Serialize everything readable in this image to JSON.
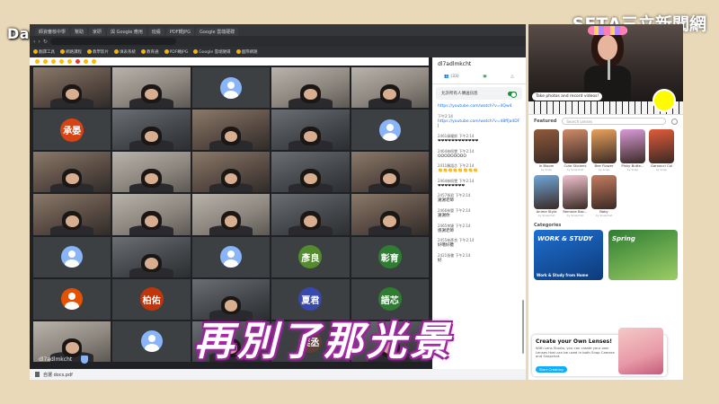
{
  "overlay": {
    "credit": "Day Liou 授權",
    "logo": "SETΛ三立新聞網"
  },
  "browser": {
    "tabs": [
      "師資審核中學",
      "幫助",
      "家研",
      "與 Google 應用",
      "班級",
      "PDF轉JPG",
      "Google 雲端硬碟"
    ],
    "bookmarks": [
      "翻譯工具",
      "網路課程",
      "教學影片",
      "填表系統",
      "教育通",
      "PDF轉JPG",
      "Google 雲端硬碟",
      "國際網路"
    ]
  },
  "meet": {
    "tiles": [
      {
        "kind": "cam",
        "tone": "warm"
      },
      {
        "kind": "cam",
        "tone": "light"
      },
      {
        "kind": "default"
      },
      {
        "kind": "cam",
        "tone": "light"
      },
      {
        "kind": "cam",
        "tone": "light"
      },
      {
        "kind": "initials",
        "label": "承晏",
        "color": "#d84315"
      },
      {
        "kind": "cam",
        "tone": "dark"
      },
      {
        "kind": "cam",
        "tone": "warm"
      },
      {
        "kind": "cam",
        "tone": "dark"
      },
      {
        "kind": "default"
      },
      {
        "kind": "cam",
        "tone": "warm"
      },
      {
        "kind": "cam",
        "tone": "light"
      },
      {
        "kind": "cam",
        "tone": "warm"
      },
      {
        "kind": "cam",
        "tone": "dark"
      },
      {
        "kind": "cam",
        "tone": "warm"
      },
      {
        "kind": "cam",
        "tone": "warm"
      },
      {
        "kind": "cam",
        "tone": "light"
      },
      {
        "kind": "cam",
        "tone": "light"
      },
      {
        "kind": "cam",
        "tone": "dark"
      },
      {
        "kind": "cam",
        "tone": "warm"
      },
      {
        "kind": "default"
      },
      {
        "kind": "cam",
        "tone": "dark"
      },
      {
        "kind": "default"
      },
      {
        "kind": "initials",
        "label": "彥良",
        "color": "#558b2f"
      },
      {
        "kind": "initials",
        "label": "彰育",
        "color": "#2e7d32"
      },
      {
        "kind": "default-orange"
      },
      {
        "kind": "initials",
        "label": "柏佑",
        "color": "#bf360c"
      },
      {
        "kind": "cam",
        "tone": "dark"
      },
      {
        "kind": "initials",
        "label": "夏君",
        "color": "#3949ab"
      },
      {
        "kind": "initials",
        "label": "語芯",
        "color": "#2e7d32"
      },
      {
        "kind": "cam",
        "tone": "light"
      },
      {
        "kind": "default"
      },
      {
        "kind": "cam",
        "tone": "dark"
      },
      {
        "kind": "initials",
        "label": "奕丞",
        "color": "#5d4037"
      },
      {
        "kind": "cam",
        "tone": "dark"
      }
    ],
    "meeting_code": "dl7adlmkcht",
    "download_file": "自選 docs.pdf"
  },
  "chat": {
    "title": "dl7adlmkcht",
    "tabs": [
      "(33)",
      "",
      ""
    ],
    "toggle_label": "允許所有人傳送訊息",
    "messages": [
      {
        "meta": "",
        "text": "https://youtube.com/watch?v=dQw4",
        "link": true
      },
      {
        "meta": "下午2:14",
        "text": "https://youtube.com/watch?v=d8ffja4DFJ",
        "link": true
      },
      {
        "meta": "2461偉曜郎 下午2:14",
        "text": "❤❤❤❤❤❤❤❤❤❤❤❤",
        "link": false
      },
      {
        "meta": "2464林佩雯 下午2:14",
        "text": "OOOOOOOOO",
        "link": false
      },
      {
        "meta": "2411陳語芯 下午2:14",
        "text": "👏👏👏👏👏👏👏👏",
        "link": false
      },
      {
        "meta": "2464林佩雯 下午2:14",
        "text": "❤❤❤❤❤❤❤❤",
        "link": false
      },
      {
        "meta": "2457張君 下午2:14",
        "text": "謝謝老師",
        "link": false
      },
      {
        "meta": "2466林晏 下午2:14",
        "text": "謝謝你",
        "link": false
      },
      {
        "meta": "2465李婕 下午2:14",
        "text": "感謝老師",
        "link": false
      },
      {
        "meta": "2455林彥良 下午2:14",
        "text": "好哦好聽",
        "link": false
      },
      {
        "meta": "2421張書 下午2:14",
        "text": "好",
        "link": false
      }
    ]
  },
  "snap": {
    "tip": "Take photos and record videos!",
    "featured_label": "Featured",
    "search_placeholder": "Search Lenses",
    "lenses": [
      {
        "name": "In Bloom",
        "author": "by Snap",
        "color": "#8e5a3c"
      },
      {
        "name": "Cute Stickers",
        "author": "by Snapchat",
        "color": "#ce8b6a"
      },
      {
        "name": "Bee Flower",
        "author": "by Snap",
        "color": "#e8a25c"
      },
      {
        "name": "Pinky Butte...",
        "author": "by Snap",
        "color": "#d99ad6"
      },
      {
        "name": "Garnacci Col",
        "author": "by Snap",
        "color": "#e05a3a"
      },
      {
        "name": "Anime Style",
        "author": "by Snapchat",
        "color": "#6fa7d8"
      },
      {
        "name": "Remove Bac...",
        "author": "by Snapchat",
        "color": "#f0c3d0"
      },
      {
        "name": "Baby",
        "author": "by Snapchat",
        "color": "#c47c60"
      }
    ],
    "categories_label": "Categories",
    "categories": [
      {
        "title": "WORK & STUDY",
        "name": "Work & Study from Home",
        "color": "#1f6fd1"
      },
      {
        "title": "Spring",
        "name": "",
        "color": "#2e7d32"
      }
    ],
    "promo": {
      "title": "Create your Own Lenses!",
      "text": "With Lens Studio, you can create your own Lenses that can be used in both Snap Camera and Snapchat.",
      "button": "Start Creating"
    }
  },
  "subtitle": "再別了那光景"
}
